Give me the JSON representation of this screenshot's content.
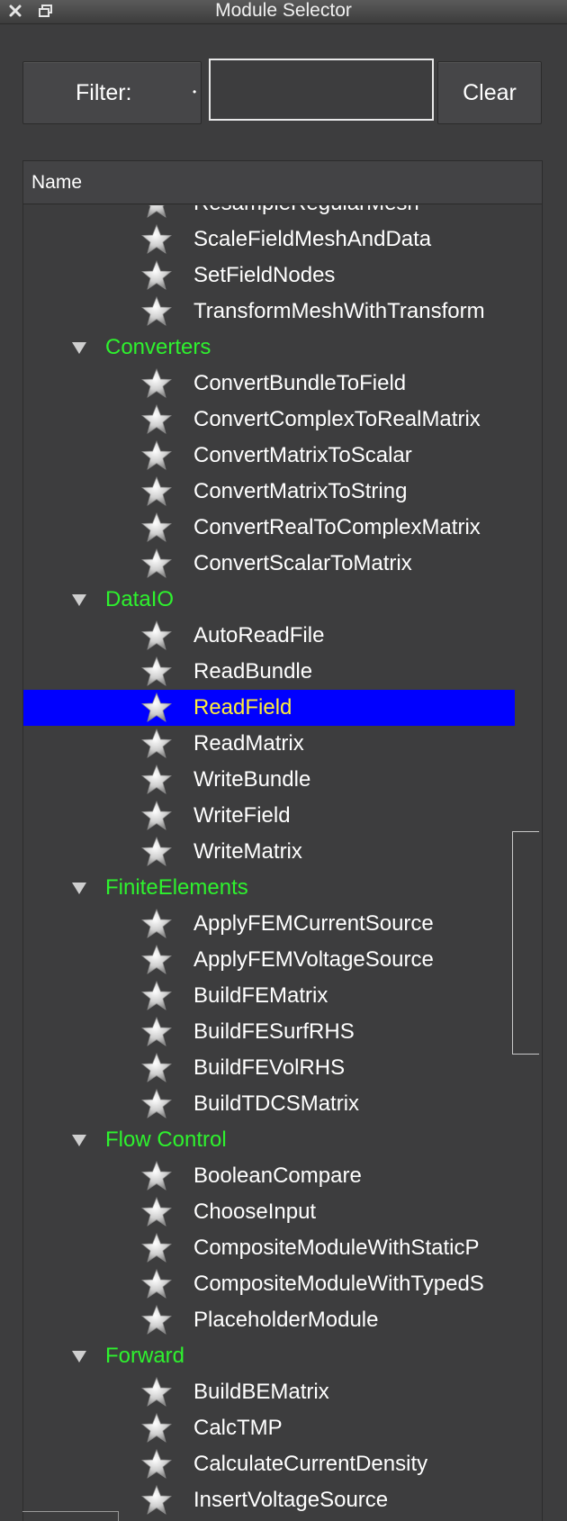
{
  "window": {
    "title": "Module Selector"
  },
  "filter": {
    "label": "Filter:",
    "value": "",
    "clear_label": "Clear"
  },
  "tree": {
    "header": "Name",
    "rows": [
      {
        "type": "leaf",
        "label": "ResampleRegularMesh"
      },
      {
        "type": "leaf",
        "label": "ScaleFieldMeshAndData"
      },
      {
        "type": "leaf",
        "label": "SetFieldNodes"
      },
      {
        "type": "leaf",
        "label": "TransformMeshWithTransform"
      },
      {
        "type": "category",
        "label": "Converters"
      },
      {
        "type": "leaf",
        "label": "ConvertBundleToField"
      },
      {
        "type": "leaf",
        "label": "ConvertComplexToRealMatrix"
      },
      {
        "type": "leaf",
        "label": "ConvertMatrixToScalar"
      },
      {
        "type": "leaf",
        "label": "ConvertMatrixToString"
      },
      {
        "type": "leaf",
        "label": "ConvertRealToComplexMatrix"
      },
      {
        "type": "leaf",
        "label": "ConvertScalarToMatrix"
      },
      {
        "type": "category",
        "label": "DataIO"
      },
      {
        "type": "leaf",
        "label": "AutoReadFile"
      },
      {
        "type": "leaf",
        "label": "ReadBundle"
      },
      {
        "type": "leaf",
        "label": "ReadField",
        "selected": true
      },
      {
        "type": "leaf",
        "label": "ReadMatrix"
      },
      {
        "type": "leaf",
        "label": "WriteBundle"
      },
      {
        "type": "leaf",
        "label": "WriteField"
      },
      {
        "type": "leaf",
        "label": "WriteMatrix"
      },
      {
        "type": "category",
        "label": "FiniteElements"
      },
      {
        "type": "leaf",
        "label": "ApplyFEMCurrentSource"
      },
      {
        "type": "leaf",
        "label": "ApplyFEMVoltageSource"
      },
      {
        "type": "leaf",
        "label": "BuildFEMatrix"
      },
      {
        "type": "leaf",
        "label": "BuildFESurfRHS"
      },
      {
        "type": "leaf",
        "label": "BuildFEVolRHS"
      },
      {
        "type": "leaf",
        "label": "BuildTDCSMatrix"
      },
      {
        "type": "category",
        "label": "Flow Control"
      },
      {
        "type": "leaf",
        "label": "BooleanCompare"
      },
      {
        "type": "leaf",
        "label": "ChooseInput"
      },
      {
        "type": "leaf",
        "label": "CompositeModuleWithStaticP"
      },
      {
        "type": "leaf",
        "label": "CompositeModuleWithTypedS"
      },
      {
        "type": "leaf",
        "label": "PlaceholderModule"
      },
      {
        "type": "category",
        "label": "Forward"
      },
      {
        "type": "leaf",
        "label": "BuildBEMatrix"
      },
      {
        "type": "leaf",
        "label": "CalcTMP"
      },
      {
        "type": "leaf",
        "label": "CalculateCurrentDensity"
      },
      {
        "type": "leaf",
        "label": "InsertVoltageSource"
      }
    ]
  },
  "icons": {
    "leaf": "star-icon",
    "category": "expand-arrow-icon",
    "close": "close-icon",
    "float": "float-window-icon"
  },
  "colors": {
    "background": "#3d3d3e",
    "category_text": "#2ef22e",
    "selection_bg": "#0000ff",
    "selection_text": "#ffee3a"
  }
}
